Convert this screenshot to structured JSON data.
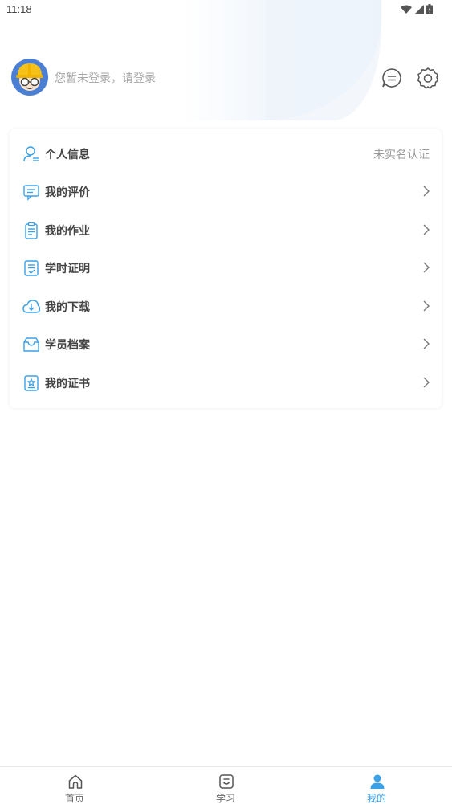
{
  "status_bar": {
    "time": "11:18"
  },
  "header": {
    "login_prompt": "您暂未登录，请登录"
  },
  "menu": {
    "items": [
      {
        "label": "个人信息",
        "right": "未实名认证",
        "icon": "user-icon"
      },
      {
        "label": "我的评价",
        "icon": "comment-icon"
      },
      {
        "label": "我的作业",
        "icon": "clipboard-icon"
      },
      {
        "label": "学时证明",
        "icon": "certificate-doc-icon"
      },
      {
        "label": "我的下载",
        "icon": "cloud-download-icon"
      },
      {
        "label": "学员档案",
        "icon": "archive-box-icon"
      },
      {
        "label": "我的证书",
        "icon": "badge-icon"
      }
    ]
  },
  "tabbar": {
    "tabs": [
      {
        "label": "首页",
        "icon": "home-icon"
      },
      {
        "label": "学习",
        "icon": "study-icon"
      },
      {
        "label": "我的",
        "icon": "person-icon",
        "active": true
      }
    ]
  },
  "colors": {
    "accent": "#3aa1e8",
    "label": "#444444",
    "muted": "#a7a7a7"
  }
}
